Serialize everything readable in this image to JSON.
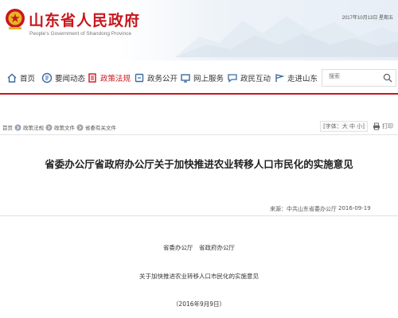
{
  "header": {
    "title": "山东省人民政府",
    "subtitle": "People's Government of Shandong Province",
    "date": "2017年10月13日 星期五"
  },
  "nav": {
    "items": [
      {
        "label": "首页",
        "icon": "home-icon"
      },
      {
        "label": "要闻动态",
        "icon": "news-icon"
      },
      {
        "label": "政策法规",
        "icon": "policy-icon"
      },
      {
        "label": "政务公开",
        "icon": "open-government-icon"
      },
      {
        "label": "网上服务",
        "icon": "online-service-icon"
      },
      {
        "label": "政民互动",
        "icon": "interaction-icon"
      },
      {
        "label": "走进山东",
        "icon": "shandong-icon"
      }
    ],
    "active_index": 2,
    "accent_color": "#c8161d",
    "search_placeholder": "搜索"
  },
  "breadcrumb": [
    "首页",
    "政策法规",
    "政策文件",
    "省委有关文件"
  ],
  "tools": {
    "font_size": "[字体：大 中 小]",
    "print": "打印"
  },
  "article": {
    "title": "省委办公厅省政府办公厅关于加快推进农业转移人口市民化的实施意见",
    "source": "来源：中共山东省委办公厅",
    "date": "2016-09-19",
    "issuers": "省委办公厅　省政府办公厅",
    "doc_title": "关于加快推进农业转移人口市民化的实施意见",
    "doc_date": "（2016年9月9日）"
  }
}
